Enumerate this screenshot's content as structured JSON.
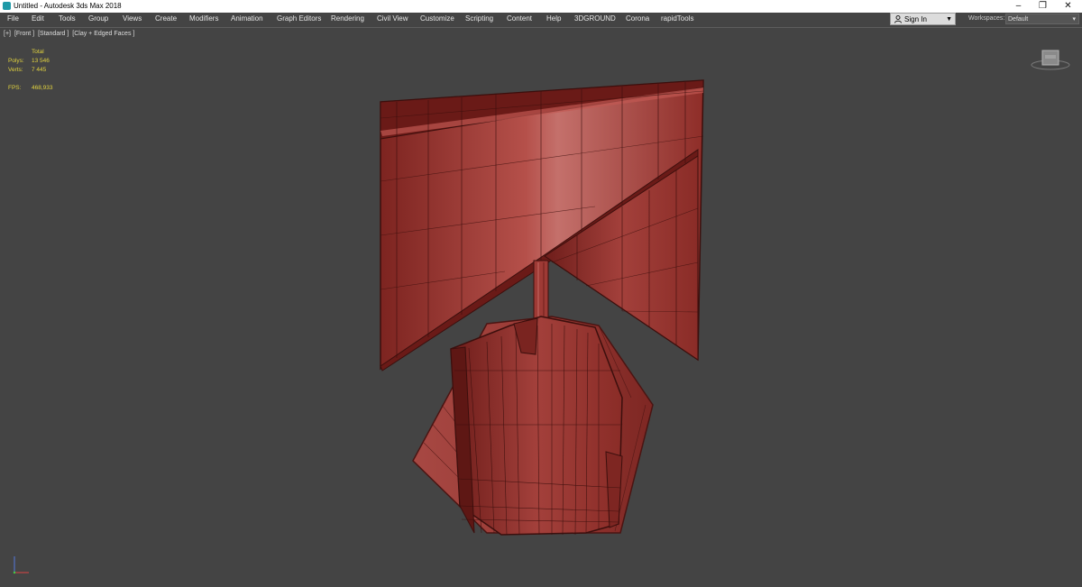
{
  "window": {
    "title": "Untitled - Autodesk 3ds Max 2018",
    "minimize_glyph": "–",
    "restore_glyph": "❐",
    "close_glyph": "✕"
  },
  "menu": {
    "items": [
      {
        "label": "File"
      },
      {
        "label": "Edit"
      },
      {
        "label": "Tools"
      },
      {
        "label": "Group"
      },
      {
        "label": "Views"
      },
      {
        "label": "Create"
      },
      {
        "label": "Modifiers"
      },
      {
        "label": "Animation"
      },
      {
        "label": "Graph Editors"
      },
      {
        "label": "Rendering"
      },
      {
        "label": "Civil View"
      },
      {
        "label": "Customize"
      },
      {
        "label": "Scripting"
      },
      {
        "label": "Content"
      },
      {
        "label": "Help"
      },
      {
        "label": "3DGROUND"
      },
      {
        "label": "Corona"
      },
      {
        "label": "rapidTools"
      }
    ],
    "sign_in": "Sign In",
    "workspaces_label": "Workspaces:",
    "workspaces_value": "Default"
  },
  "viewport": {
    "label_parts": [
      "[+]",
      "[Front ]",
      "[Standard ]",
      "[Clay + Edged Faces ]"
    ],
    "stats": {
      "header": "Total",
      "polys_label": "Polys:",
      "polys_value": "13 546",
      "verts_label": "Verts:",
      "verts_value": "7 445",
      "fps_label": "FPS:",
      "fps_value": "468,933"
    }
  },
  "colors": {
    "viewport_bg": "#444444",
    "model_red": "#a63a35",
    "stats_yellow": "#e1d23f"
  }
}
